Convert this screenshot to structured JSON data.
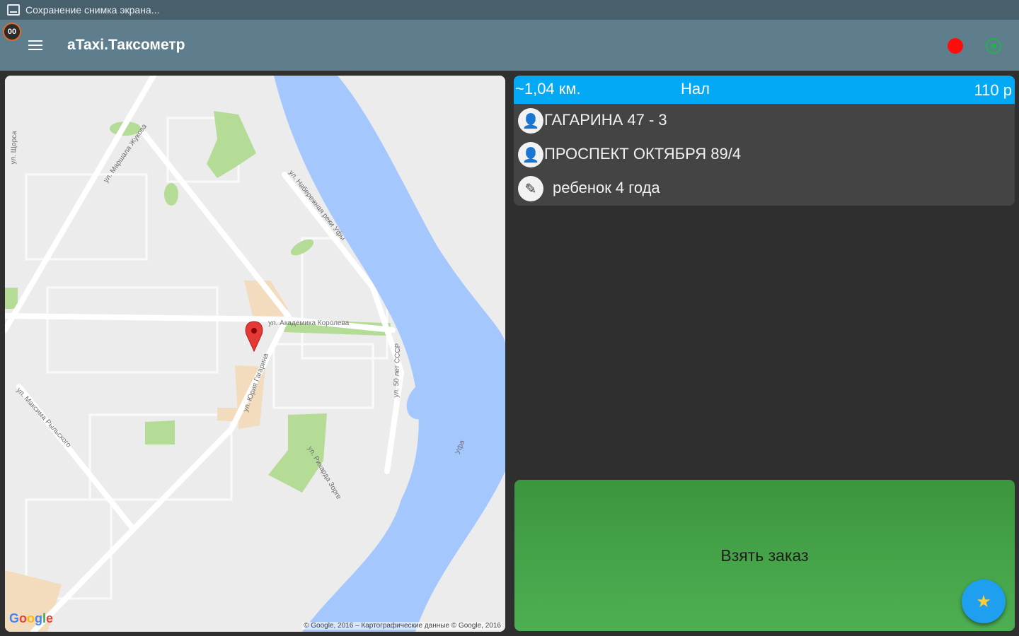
{
  "statusbar": {
    "notification": "Сохранение снимка экрана..."
  },
  "appbar": {
    "title": "aTaxi.Таксометр",
    "rec_badge": "00"
  },
  "map": {
    "streets": [
      "ул. Щорса",
      "ул. Маршала Жукова",
      "ул. Набережная реки Уфы",
      "ул. Академика Королева",
      "ул. Юрия Гагарина",
      "ул. 50 лет СССР",
      "ул. Максима Рыльского",
      "ул. Рихарда Зорге",
      "Уфа"
    ],
    "google_logo": "Google",
    "copyright": "© Google, 2016 – Картографические данные © Google, 2016"
  },
  "order": {
    "distance": "~1,04 км.",
    "payment": "Нал",
    "price": "110 р",
    "addresses": [
      "ГАГАРИНА 47 - 3",
      "ПРОСПЕКТ ОКТЯБРЯ 89/4"
    ],
    "note": "ребенок 4 года"
  },
  "actions": {
    "take_order": "Взять заказ"
  },
  "colors": {
    "header_accent": "#03a9f4",
    "take_button": "#4caf50",
    "recording_dot": "#ff0d0d",
    "gps_status": "#23b14d",
    "fab": "#1e9ff0"
  },
  "icons": [
    "screenshot-icon",
    "menu-icon",
    "record-dot-icon",
    "gps-icon",
    "map-pin-icon",
    "person-icon",
    "pencil-icon",
    "star-icon"
  ]
}
